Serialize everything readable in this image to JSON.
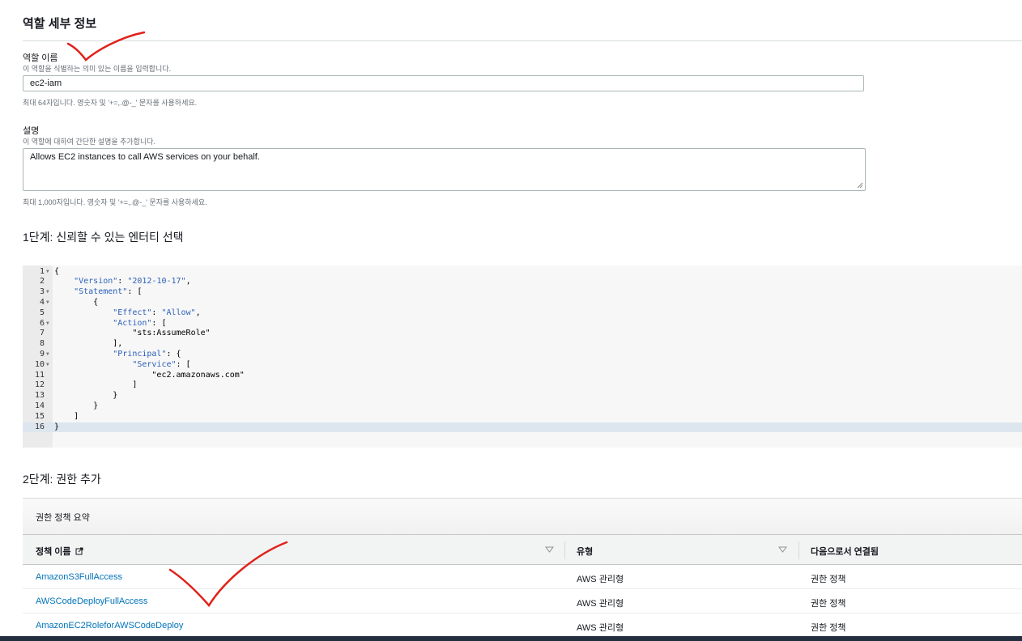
{
  "details": {
    "title": "역할 세부 정보",
    "name_label": "역할 이름",
    "name_desc": "이 역할을 식별하는 의미 있는 이름을 입력합니다.",
    "name_value": "ec2-iam",
    "name_hint": "최대 64자입니다. 영숫자 및 '+=,.@-_' 문자를 사용하세요.",
    "desc_label": "설명",
    "desc_desc": "이 역할에 대하여 간단한 설명을 추가합니다.",
    "desc_value": "Allows EC2 instances to call AWS services on your behalf.",
    "desc_hint": "최대 1,000자입니다. 영숫자 및 '+=,.@-_' 문자를 사용하세요."
  },
  "step1": {
    "title": "1단계: 신뢰할 수 있는 엔터티 선택",
    "lines": [
      {
        "n": "1",
        "fold": true,
        "t": "{"
      },
      {
        "n": "2",
        "fold": false,
        "t": "    \"Version\": \"2012-10-17\","
      },
      {
        "n": "3",
        "fold": true,
        "t": "    \"Statement\": ["
      },
      {
        "n": "4",
        "fold": true,
        "t": "        {"
      },
      {
        "n": "5",
        "fold": false,
        "t": "            \"Effect\": \"Allow\","
      },
      {
        "n": "6",
        "fold": true,
        "t": "            \"Action\": ["
      },
      {
        "n": "7",
        "fold": false,
        "t": "                \"sts:AssumeRole\""
      },
      {
        "n": "8",
        "fold": false,
        "t": "            ],"
      },
      {
        "n": "9",
        "fold": true,
        "t": "            \"Principal\": {"
      },
      {
        "n": "10",
        "fold": true,
        "t": "                \"Service\": ["
      },
      {
        "n": "11",
        "fold": false,
        "t": "                    \"ec2.amazonaws.com\""
      },
      {
        "n": "12",
        "fold": false,
        "t": "                ]"
      },
      {
        "n": "13",
        "fold": false,
        "t": "            }"
      },
      {
        "n": "14",
        "fold": false,
        "t": "        }"
      },
      {
        "n": "15",
        "fold": false,
        "t": "    ]"
      },
      {
        "n": "16",
        "fold": false,
        "t": "}"
      }
    ]
  },
  "step2": {
    "title": "2단계: 권한 추가",
    "panel_title": "권한 정책 요약",
    "columns": [
      "정책 이름",
      "유형",
      "다음으로서 연결됨"
    ],
    "rows": [
      {
        "name": "AmazonS3FullAccess",
        "type": "AWS 관리형",
        "attached": "권한 정책"
      },
      {
        "name": "AWSCodeDeployFullAccess",
        "type": "AWS 관리형",
        "attached": "권한 정책"
      },
      {
        "name": "AmazonEC2RoleforAWSCodeDeploy",
        "type": "AWS 관리형",
        "attached": "권한 정책"
      }
    ]
  },
  "colors": {
    "link": "#0073bb",
    "annotation": "#e0221b",
    "code_key": "#2d61b9"
  },
  "icons": [
    "external-link-icon",
    "sort-down-icon",
    "fold-arrow-icon",
    "resize-handle-icon"
  ]
}
